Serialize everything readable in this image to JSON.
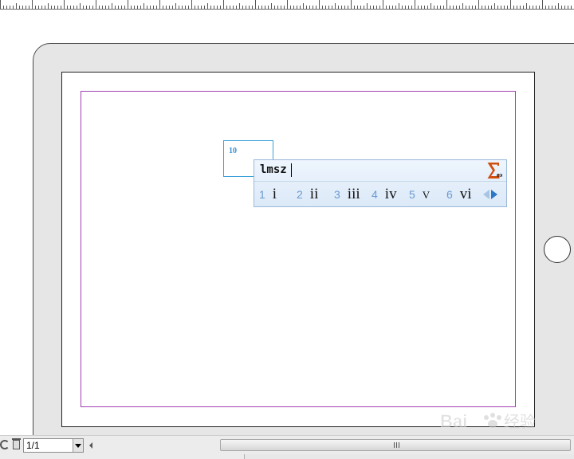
{
  "text_frame": {
    "content": "10"
  },
  "ime": {
    "input_text": "lmsz",
    "candidates": [
      {
        "index": "1",
        "value": "i"
      },
      {
        "index": "2",
        "value": "ii"
      },
      {
        "index": "3",
        "value": "iii"
      },
      {
        "index": "4",
        "value": "iv"
      },
      {
        "index": "5",
        "value": "v"
      },
      {
        "index": "6",
        "value": "vi"
      }
    ],
    "icons": {
      "symbol": "sigma-icon",
      "prev": "arrow-left-icon",
      "next": "arrow-right-icon"
    }
  },
  "statusbar": {
    "page_selector_value": "1/1",
    "scroll_grip": "III"
  },
  "colors": {
    "margin_guide": "#a040b0",
    "frame_border": "#3aa0d8",
    "candidate_index": "#6a9ad0",
    "sigma": "#d05010"
  }
}
